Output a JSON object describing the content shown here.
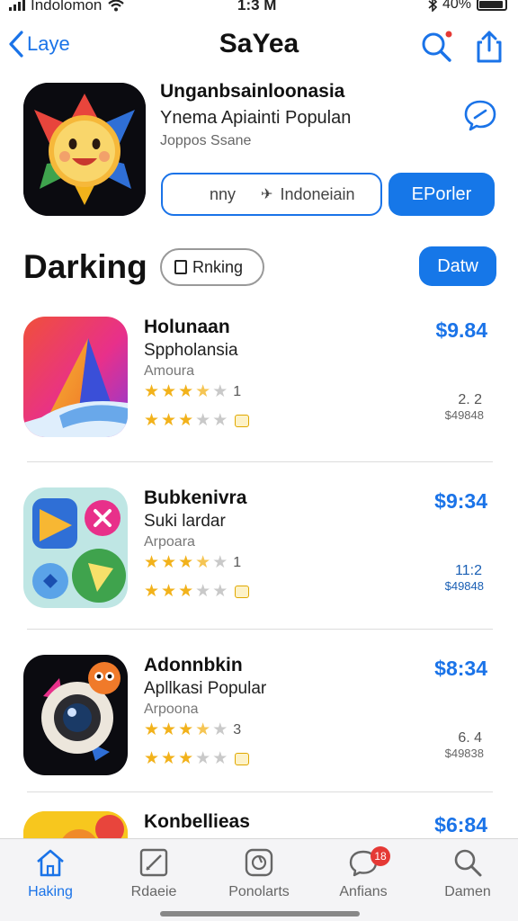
{
  "status_bar": {
    "carrier": "Indolomon",
    "time": "1:3 M",
    "battery": "40%"
  },
  "nav": {
    "back_label": "Laye",
    "title": "SaYea"
  },
  "hero": {
    "title": "Unganbsainloonasia",
    "subtitle": "Ynema Apiainti Populan",
    "meta": "Joppos Ssane",
    "region_lead": "nny",
    "region_label": "Indoneiain",
    "button_label": "EPorler"
  },
  "section": {
    "title": "Darking",
    "pill_label": "Rnking",
    "button_label": "Datw"
  },
  "apps": [
    {
      "name": "Holunaan",
      "category": "Sppholansia",
      "developer": "Amoura",
      "price": "$9.84",
      "rating_count": "1",
      "rank": "2. 2",
      "rank_sub": "$49848"
    },
    {
      "name": "Bubkenivra",
      "category": "Suki lardar",
      "developer": "Arpoara",
      "price": "$9:34",
      "rating_count": "1",
      "rank": "11:2",
      "rank_sub": "$49848"
    },
    {
      "name": "Adonnbkin",
      "category": "Apllkasi Popular",
      "developer": "Arpoona",
      "price": "$8:34",
      "rating_count": "3",
      "rank": "6. 4",
      "rank_sub": "$49838"
    },
    {
      "name": "Konbellieas",
      "price": "$6:84"
    }
  ],
  "tabs": [
    {
      "label": "Haking"
    },
    {
      "label": "Rdaeie"
    },
    {
      "label": "Ponolarts"
    },
    {
      "label": "Anfians",
      "badge": "18"
    },
    {
      "label": "Damen"
    }
  ],
  "colors": {
    "accent": "#1a73e8",
    "star": "#f2b21b",
    "badge": "#e53935"
  }
}
